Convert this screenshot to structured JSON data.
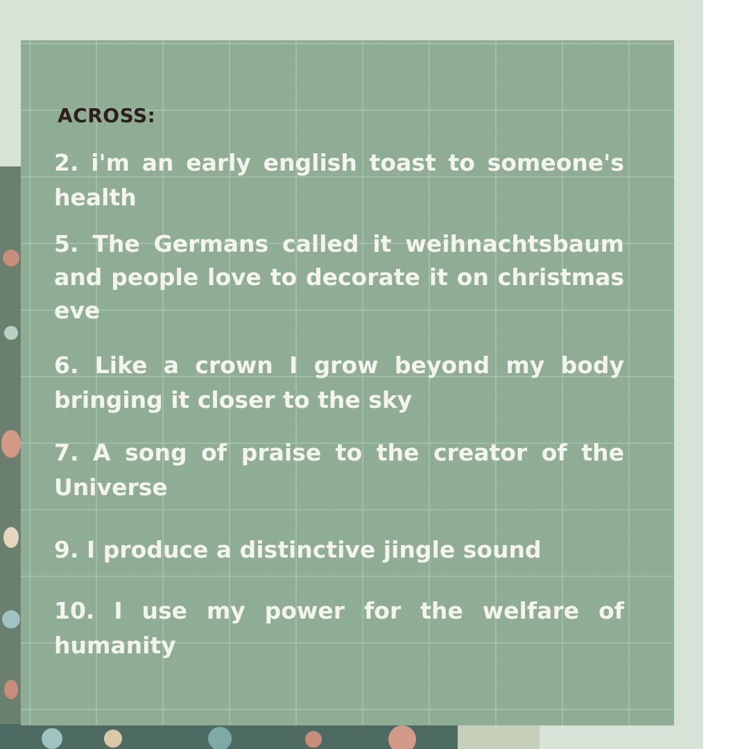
{
  "heading": "ACROSS:",
  "clues": [
    "2. i'm an early english toast to someone's health",
    "5. The Germans called it weihnachtsbaum and people love to decorate it on christmas eve",
    "6. Like a crown I grow beyond my body bringing it closer to the sky",
    "7. A song of praise to the creator of the Universe",
    "9. I  produce a distinctive jingle sound",
    "10. I  use my power for the welfare of humanity"
  ],
  "colors": {
    "background": "#d6e3d6",
    "card": "#8fac95",
    "heading_text": "#2c1f1c",
    "clue_text": "#f3f4ee"
  }
}
